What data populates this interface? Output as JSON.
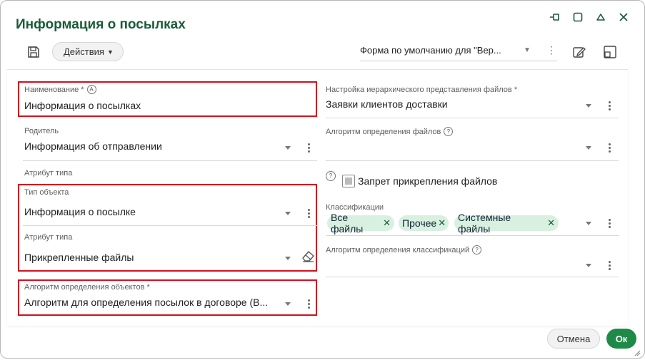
{
  "dialog": {
    "title": "Информация о посылках",
    "accent_color": "#1a5c38",
    "highlight_color": "#d4101c"
  },
  "toolbar": {
    "actions_label": "Действия",
    "form_selector": "Форма по умолчанию для \"Вер..."
  },
  "left": {
    "name_label": "Наименование *",
    "name_value": "Информация о посылках",
    "parent_label": "Родитель",
    "parent_value": "Информация об отправлении",
    "type_attr_header": "Атрибут типа",
    "object_type_label": "Тип объекта",
    "object_type_value": "Информация о посылке",
    "type_attr_label": "Атрибут типа",
    "type_attr_value": "Прикрепленные файлы",
    "algorithm_label": "Алгоритм определения объектов *",
    "algorithm_value": "Алгоритм для определения посылок в договоре (В..."
  },
  "right": {
    "hier_label": "Настройка иерархического представления файлов *",
    "hier_value": "Заявки клиентов доставки",
    "file_algo_label": "Алгоритм определения файлов",
    "file_algo_value": "",
    "ban_label": "Запрет прикрепления файлов",
    "class_label": "Классификации",
    "chips": [
      "Все файлы",
      "Прочее",
      "Системные файлы"
    ],
    "class_algo_label": "Алгоритм определения классификаций",
    "class_algo_value": ""
  },
  "footer": {
    "cancel_label": "Отмена",
    "ok_label": "Ок",
    "ok_color": "#1f8a47"
  }
}
